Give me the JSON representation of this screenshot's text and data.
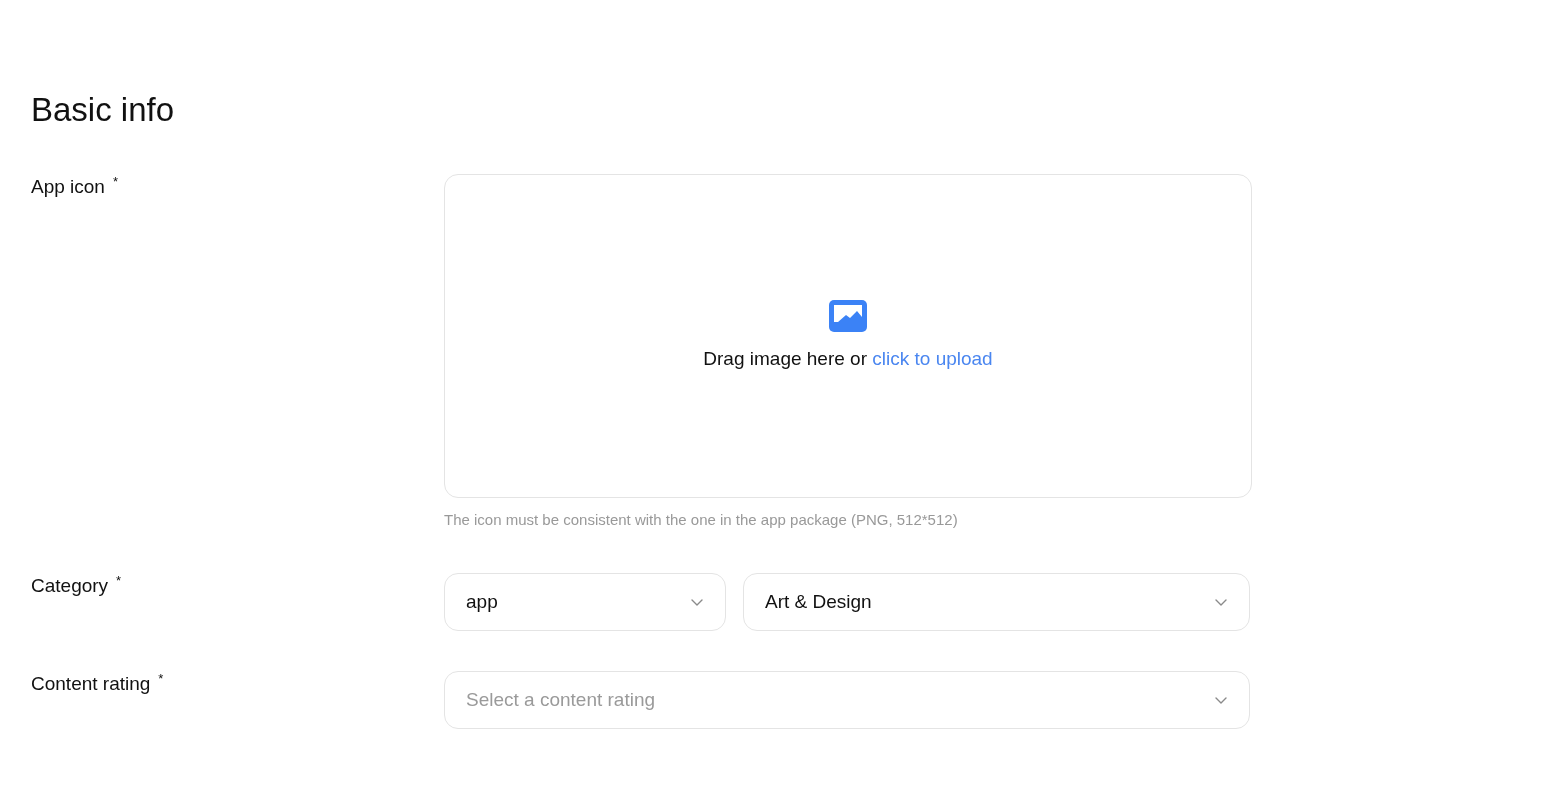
{
  "title": "Basic info",
  "fields": [
    {
      "kind": "upload",
      "label": "App icon",
      "required_mark": "*",
      "upload": {
        "prompt": "Drag image here or",
        "link": "click to upload"
      },
      "hint": "The icon must be consistent with the one in the app package (PNG, 512*512)"
    },
    {
      "kind": "selects",
      "label": "Category",
      "required_mark": "*",
      "selects": [
        {
          "value": "app"
        },
        {
          "value": "Art & Design"
        }
      ]
    },
    {
      "kind": "selects",
      "label": "Content rating",
      "required_mark": "*",
      "selects": [
        {
          "placeholder": "Select a content rating"
        }
      ]
    }
  ]
}
